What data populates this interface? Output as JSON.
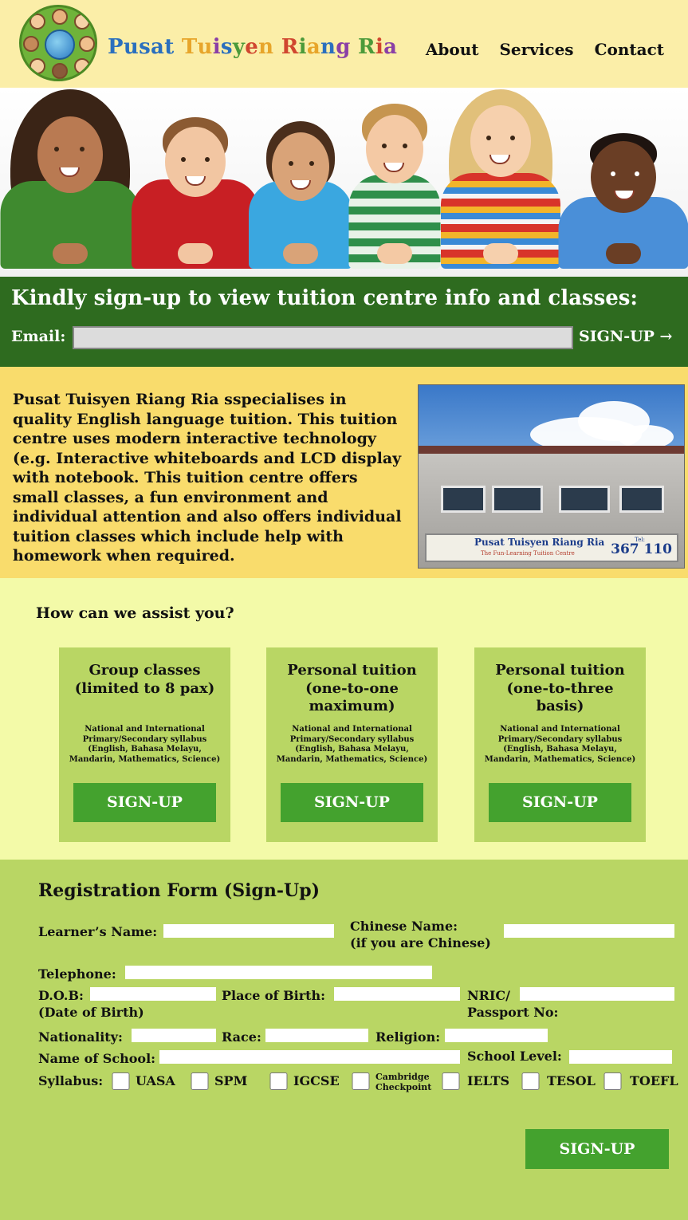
{
  "header": {
    "brand_letters": [
      {
        "ch": "P",
        "color": "#2a6fbe"
      },
      {
        "ch": "u",
        "color": "#2a6fbe"
      },
      {
        "ch": "s",
        "color": "#2a6fbe"
      },
      {
        "ch": "a",
        "color": "#2a6fbe"
      },
      {
        "ch": "t",
        "color": "#2a6fbe"
      },
      {
        "ch": " ",
        "color": "#2a6fbe"
      },
      {
        "ch": "T",
        "color": "#e7a52a"
      },
      {
        "ch": "u",
        "color": "#e7a52a"
      },
      {
        "ch": "i",
        "color": "#8a3fa6"
      },
      {
        "ch": "s",
        "color": "#2a6fbe"
      },
      {
        "ch": "y",
        "color": "#4b9a3a"
      },
      {
        "ch": "e",
        "color": "#d0462f"
      },
      {
        "ch": "n",
        "color": "#e7a52a"
      },
      {
        "ch": " ",
        "color": "#2a6fbe"
      },
      {
        "ch": "R",
        "color": "#d0462f"
      },
      {
        "ch": "i",
        "color": "#4b9a3a"
      },
      {
        "ch": "a",
        "color": "#e7a52a"
      },
      {
        "ch": "n",
        "color": "#2a6fbe"
      },
      {
        "ch": "g",
        "color": "#8a3fa6"
      },
      {
        "ch": " ",
        "color": "#2a6fbe"
      },
      {
        "ch": "R",
        "color": "#4b9a3a"
      },
      {
        "ch": "i",
        "color": "#d0462f"
      },
      {
        "ch": "a",
        "color": "#8a3fa6"
      }
    ],
    "nav": [
      "About",
      "Services",
      "Contact"
    ]
  },
  "banner": {
    "heading": "Kindly sign-up to view tuition centre info and classes:",
    "email_label": "Email:",
    "email_value": "",
    "signup_label": "SIGN-UP →"
  },
  "about": {
    "text": "Pusat Tuisyen Riang Ria sspecialises in quality English language tuition. This tuition centre uses modern interactive technology (e.g. Interactive whiteboards and LCD display with notebook. This tuition centre offers small classes, a fun environment and individual attention and also offers individual tuition classes which include help with homework when required.",
    "sign_name": "Pusat Tuisyen Riang Ria",
    "sign_tagline": "The Fun-Learning Tuition Centre",
    "sign_tel_label": "Tel:",
    "sign_tel": "367 110"
  },
  "services": {
    "heading": "How can we assist you?",
    "cards": [
      {
        "title": "Group classes (limited to 8 pax)",
        "desc": "National and International Primary/Secondary syllabus (English, Bahasa Melayu, Mandarin, Mathematics, Science)",
        "button": "SIGN-UP"
      },
      {
        "title": "Personal tuition (one-to-one maximum)",
        "desc": "National and International Primary/Secondary syllabus (English, Bahasa Melayu, Mandarin, Mathematics, Science)",
        "button": "SIGN-UP"
      },
      {
        "title": "Personal tuition (one-to-three basis)",
        "desc": "National and International Primary/Secondary syllabus (English, Bahasa Melayu, Mandarin, Mathematics, Science)",
        "button": "SIGN-UP"
      }
    ]
  },
  "registration": {
    "heading": "Registration Form (Sign-Up)",
    "labels": {
      "learner_name": "Learner’s Name:",
      "chinese_name": "Chinese Name:",
      "chinese_name_note": "(if you are Chinese)",
      "telephone": "Telephone:",
      "dob": "D.O.B:",
      "dob_note": "(Date of Birth)",
      "place_of_birth": "Place of Birth:",
      "nric": "NRIC/",
      "passport": "Passport No:",
      "nationality": "Nationality:",
      "race": "Race:",
      "religion": "Religion:",
      "school_name": "Name of School:",
      "school_level": "School Level:",
      "syllabus": "Syllabus:"
    },
    "syllabus_options": [
      "UASA",
      "SPM",
      "IGCSE",
      "Cambridge",
      "Checkpoint",
      "IELTS",
      "TESOL",
      "TOEFL"
    ],
    "submit": "SIGN-UP"
  }
}
